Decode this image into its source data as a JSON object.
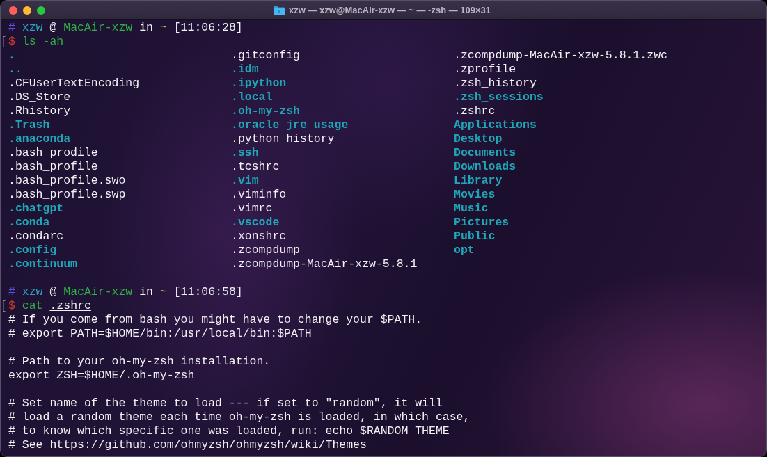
{
  "window": {
    "title": "xzw — xzw@MacAir-xzw — ~ — -zsh — 109×31"
  },
  "sessions": [
    {
      "kind": "listing",
      "prompt": {
        "symbol": "#",
        "user": "xzw",
        "at": "@",
        "host": "MacAir-xzw",
        "in": "in",
        "cwd": "~",
        "time": "[11:06:28]"
      },
      "command": {
        "symbol": "$",
        "name": "ls",
        "argument": "-ah",
        "is_path": false
      },
      "entries": [
        {
          "name": ".",
          "kind": "dir"
        },
        {
          "name": "..",
          "kind": "dir"
        },
        {
          "name": ".CFUserTextEncoding",
          "kind": "file"
        },
        {
          "name": ".DS_Store",
          "kind": "file"
        },
        {
          "name": ".Rhistory",
          "kind": "file"
        },
        {
          "name": ".Trash",
          "kind": "dir"
        },
        {
          "name": ".anaconda",
          "kind": "dir"
        },
        {
          "name": ".bash_prodile",
          "kind": "file"
        },
        {
          "name": ".bash_profile",
          "kind": "file"
        },
        {
          "name": ".bash_profile.swo",
          "kind": "file"
        },
        {
          "name": ".bash_profile.swp",
          "kind": "file"
        },
        {
          "name": ".chatgpt",
          "kind": "dir"
        },
        {
          "name": ".conda",
          "kind": "dir"
        },
        {
          "name": ".condarc",
          "kind": "file"
        },
        {
          "name": ".config",
          "kind": "dir"
        },
        {
          "name": ".continuum",
          "kind": "dir"
        },
        {
          "name": ".gitconfig",
          "kind": "file"
        },
        {
          "name": ".idm",
          "kind": "dir"
        },
        {
          "name": ".ipython",
          "kind": "dir"
        },
        {
          "name": ".local",
          "kind": "dir"
        },
        {
          "name": ".oh-my-zsh",
          "kind": "dir"
        },
        {
          "name": ".oracle_jre_usage",
          "kind": "dir"
        },
        {
          "name": ".python_history",
          "kind": "file"
        },
        {
          "name": ".ssh",
          "kind": "dir"
        },
        {
          "name": ".tcshrc",
          "kind": "file"
        },
        {
          "name": ".vim",
          "kind": "dir"
        },
        {
          "name": ".viminfo",
          "kind": "file"
        },
        {
          "name": ".vimrc",
          "kind": "file"
        },
        {
          "name": ".vscode",
          "kind": "dir"
        },
        {
          "name": ".xonshrc",
          "kind": "file"
        },
        {
          "name": ".zcompdump",
          "kind": "file"
        },
        {
          "name": ".zcompdump-MacAir-xzw-5.8.1",
          "kind": "file"
        },
        {
          "name": ".zcompdump-MacAir-xzw-5.8.1.zwc",
          "kind": "file"
        },
        {
          "name": ".zprofile",
          "kind": "file"
        },
        {
          "name": ".zsh_history",
          "kind": "file"
        },
        {
          "name": ".zsh_sessions",
          "kind": "dir"
        },
        {
          "name": ".zshrc",
          "kind": "file"
        },
        {
          "name": "Applications",
          "kind": "dir"
        },
        {
          "name": "Desktop",
          "kind": "dir"
        },
        {
          "name": "Documents",
          "kind": "dir"
        },
        {
          "name": "Downloads",
          "kind": "dir"
        },
        {
          "name": "Library",
          "kind": "dir"
        },
        {
          "name": "Movies",
          "kind": "dir"
        },
        {
          "name": "Music",
          "kind": "dir"
        },
        {
          "name": "Pictures",
          "kind": "dir"
        },
        {
          "name": "Public",
          "kind": "dir"
        },
        {
          "name": "opt",
          "kind": "dir"
        }
      ]
    },
    {
      "kind": "text",
      "prompt": {
        "symbol": "#",
        "user": "xzw",
        "at": "@",
        "host": "MacAir-xzw",
        "in": "in",
        "cwd": "~",
        "time": "[11:06:58]"
      },
      "command": {
        "symbol": "$",
        "name": "cat",
        "argument": ".zshrc",
        "is_path": true
      },
      "paragraphs": [
        [
          "# If you come from bash you might have to change your $PATH.",
          "# export PATH=$HOME/bin:/usr/local/bin:$PATH"
        ],
        [
          "# Path to your oh-my-zsh installation.",
          "export ZSH=$HOME/.oh-my-zsh"
        ],
        [
          "# Set name of the theme to load --- if set to \"random\", it will",
          "# load a random theme each time oh-my-zsh is loaded, in which case,",
          "# to know which specific one was loaded, run: echo $RANDOM_THEME",
          "# See https://github.com/ohmyzsh/ohmyzsh/wiki/Themes"
        ]
      ]
    }
  ]
}
